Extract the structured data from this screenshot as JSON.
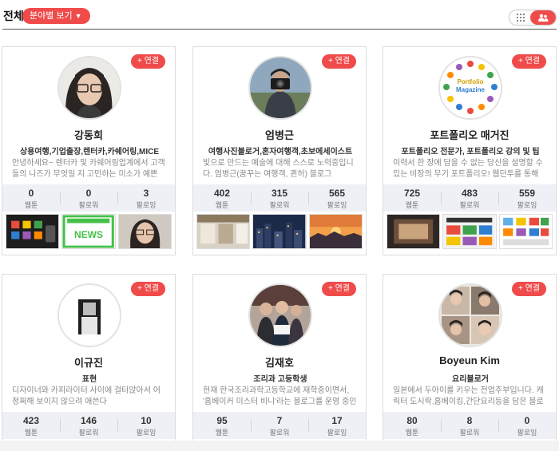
{
  "header": {
    "title": "전체",
    "filter_label": "분야별 보기",
    "view_grid_icon": "grid-icon",
    "view_people_icon": "people-icon"
  },
  "colors": {
    "accent": "#f04b4b",
    "stats_bg": "#eef0f5"
  },
  "link_label": "+ 연결",
  "stat_labels": {
    "webtoon": "웹툰",
    "followers": "팔로워",
    "following": "팔로잉"
  },
  "cards": [
    {
      "name": "강동희",
      "tagline": "상용여행,기업출장,렌터카,카쉐어링,MICE",
      "desc": "안녕하세요~ 렌터카 및 카쉐어링업계에서 고객들의 니즈가 무엇일 지 고민하는 미소가 예쁜 취",
      "webtoon": "0",
      "followers": "0",
      "following": "3"
    },
    {
      "name": "엄병근",
      "tagline": "여행사진블로거,혼자여행객,초보에세이스트",
      "desc": "빛으로 만드는 예술에 대해 스스로 노력중입니다. 엄병근(꿈꾸는 여행객, 퀸허) 블로그",
      "webtoon": "402",
      "followers": "315",
      "following": "565"
    },
    {
      "name": "포트폴리오 매거진",
      "tagline": "포트폴리오 전문가, 포트폴리오 강의 및 팁",
      "desc": "이력서 한 장에 담을 수 없는 당신을 설명할 수 있는 비장의 무기 포트폴리오! 웹던투를 통해 더",
      "webtoon": "725",
      "followers": "483",
      "following": "559"
    },
    {
      "name": "이규진",
      "tagline": "표현",
      "desc": "디자이너와 카피라이터 사이에 걸터앉아서 어정쩌해 보이지 않으려 애쓴다",
      "webtoon": "423",
      "followers": "146",
      "following": "10"
    },
    {
      "name": "김재호",
      "tagline": "조리과 고등학생",
      "desc": "현재 한국조리과학고등학교에 재학중이면서, '홈베이커 미스터 비니'라는 블로그를 운영 중인 고",
      "webtoon": "95",
      "followers": "7",
      "following": "17"
    },
    {
      "name": "Boyeun Kim",
      "tagline": "요리블로거",
      "desc": "일본에서 두아이를 키우는 전업주부입니다. 캐릭터 도시락,홈베이킹,간단요리등을 담은 블로",
      "webtoon": "80",
      "followers": "8",
      "following": "0"
    }
  ],
  "thumb_news_label": "NEWS",
  "portfolio_logo_text": [
    "Portfolio",
    "Magazine"
  ]
}
